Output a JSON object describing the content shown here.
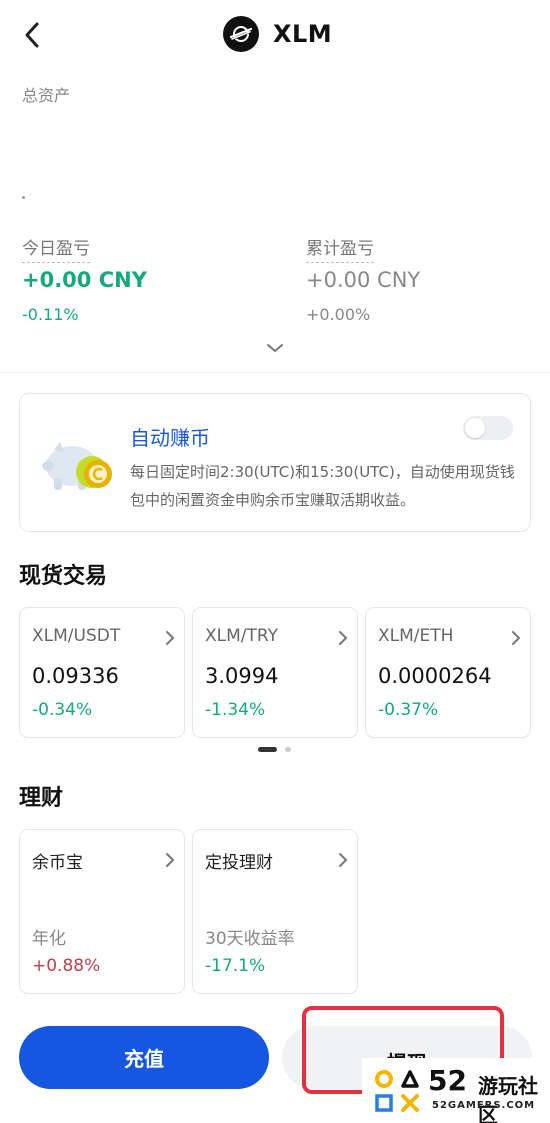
{
  "header": {
    "title": "XLM"
  },
  "assets": {
    "total_label": "总资产"
  },
  "pnl": {
    "today": {
      "label": "今日盈亏",
      "value": "+0.00 CNY",
      "percent": "-0.11%"
    },
    "cumulative": {
      "label": "累计盈亏",
      "value": "+0.00 CNY",
      "percent": "+0.00%"
    }
  },
  "auto_earn": {
    "title": "自动赚币",
    "description": "每日固定时间2:30(UTC)和15:30(UTC)，自动使用现货钱包中的闲置资金申购余币宝赚取活期收益。",
    "enabled": false
  },
  "spot": {
    "title": "现货交易",
    "pairs": [
      {
        "name": "XLM/USDT",
        "price": "0.09336",
        "change": "-0.34%"
      },
      {
        "name": "XLM/TRY",
        "price": "3.0994",
        "change": "-1.34%"
      },
      {
        "name": "XLM/ETH",
        "price": "0.0000264",
        "change": "-0.37%"
      }
    ]
  },
  "finance": {
    "title": "理财",
    "products": [
      {
        "name": "余币宝",
        "rate_label": "年化",
        "rate": "+0.88%"
      },
      {
        "name": "定投理财",
        "rate_label": "30天收益率",
        "rate": "-17.1%"
      }
    ]
  },
  "actions": {
    "deposit": "充值",
    "withdraw": "提现"
  },
  "watermark": {
    "number": "52",
    "text": "游玩社区",
    "sub": "52GAMERS.COM"
  },
  "colors": {
    "positive": "#15a97f",
    "negative_red": "#c0404c",
    "primary": "#1557e0",
    "highlight": "#e0323f"
  }
}
